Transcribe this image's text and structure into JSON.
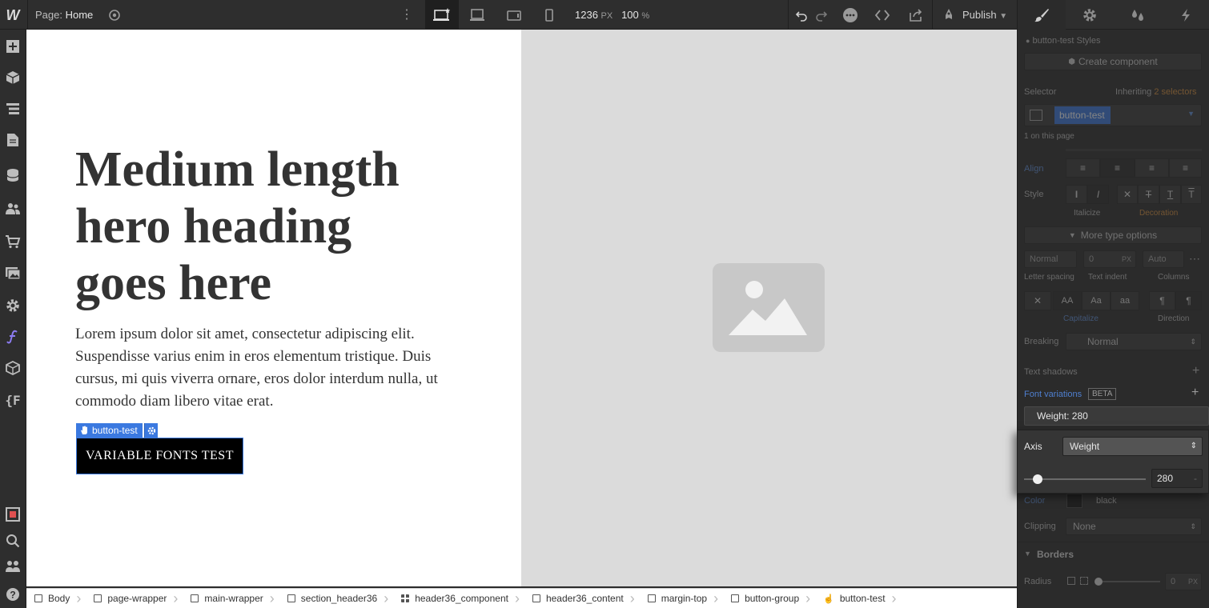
{
  "topbar": {
    "logo": "W",
    "page_label": "Page:",
    "page_name": "Home",
    "width_value": "1236",
    "width_unit": "PX",
    "zoom_value": "100",
    "zoom_unit": "%",
    "publish_label": "Publish"
  },
  "canvas": {
    "heading": "Medium length hero heading goes here",
    "paragraph": "Lorem ipsum dolor sit amet, consectetur adipiscing elit. Suspendisse varius enim in eros elementum tristique. Duis cursus, mi quis viverra ornare, eros dolor interdum nulla, ut commodo diam libero vitae erat.",
    "selection_tag": "button-test",
    "button_label": "VARIABLE FONTS TEST"
  },
  "breadcrumbs": [
    {
      "label": "Body",
      "icon": "body-icon"
    },
    {
      "label": "page-wrapper",
      "icon": "box-icon"
    },
    {
      "label": "main-wrapper",
      "icon": "box-icon"
    },
    {
      "label": "section_header36",
      "icon": "box-icon"
    },
    {
      "label": "header36_component",
      "icon": "grid-icon"
    },
    {
      "label": "header36_content",
      "icon": "box-icon"
    },
    {
      "label": "margin-top",
      "icon": "box-icon"
    },
    {
      "label": "button-group",
      "icon": "box-icon"
    },
    {
      "label": "button-test",
      "icon": "hand-icon"
    }
  ],
  "panel": {
    "styles_title": "button-test Styles",
    "create_component": "Create component",
    "selector_label": "Selector",
    "inheriting_prefix": "Inheriting",
    "inheriting_count": "2 selectors",
    "selector_chip": "button-test",
    "on_page": "1 on this page",
    "align_label": "Align",
    "style_label": "Style",
    "italicize_label": "Italicize",
    "decoration_label": "Decoration",
    "more_type_options": "More type options",
    "letter_spacing_value": "Normal",
    "text_indent_value": "0",
    "text_indent_unit": "PX",
    "columns_value": "Auto",
    "letter_spacing_label": "Letter spacing",
    "text_indent_label": "Text indent",
    "columns_label": "Columns",
    "capitalize_label": "Capitalize",
    "direction_label": "Direction",
    "breaking_label": "Breaking",
    "breaking_value": "Normal",
    "text_shadows_label": "Text shadows",
    "font_variations_label": "Font variations",
    "beta_badge": "BETA",
    "weight_row": "Weight: 280",
    "axis_label": "Axis",
    "axis_value": "Weight",
    "weight_value": "280",
    "weight_fraction": 0.11,
    "color_label": "Color",
    "color_value": "black",
    "clipping_label": "Clipping",
    "clipping_value": "None",
    "borders_label": "Borders",
    "radius_label": "Radius",
    "radius_value": "0",
    "radius_unit": "PX"
  },
  "colors": {
    "accent_blue": "#3b79e0",
    "inherit_orange": "#d88f3c",
    "panel_bg": "#2b2b2b",
    "image_bg": "#dbdbdb"
  }
}
